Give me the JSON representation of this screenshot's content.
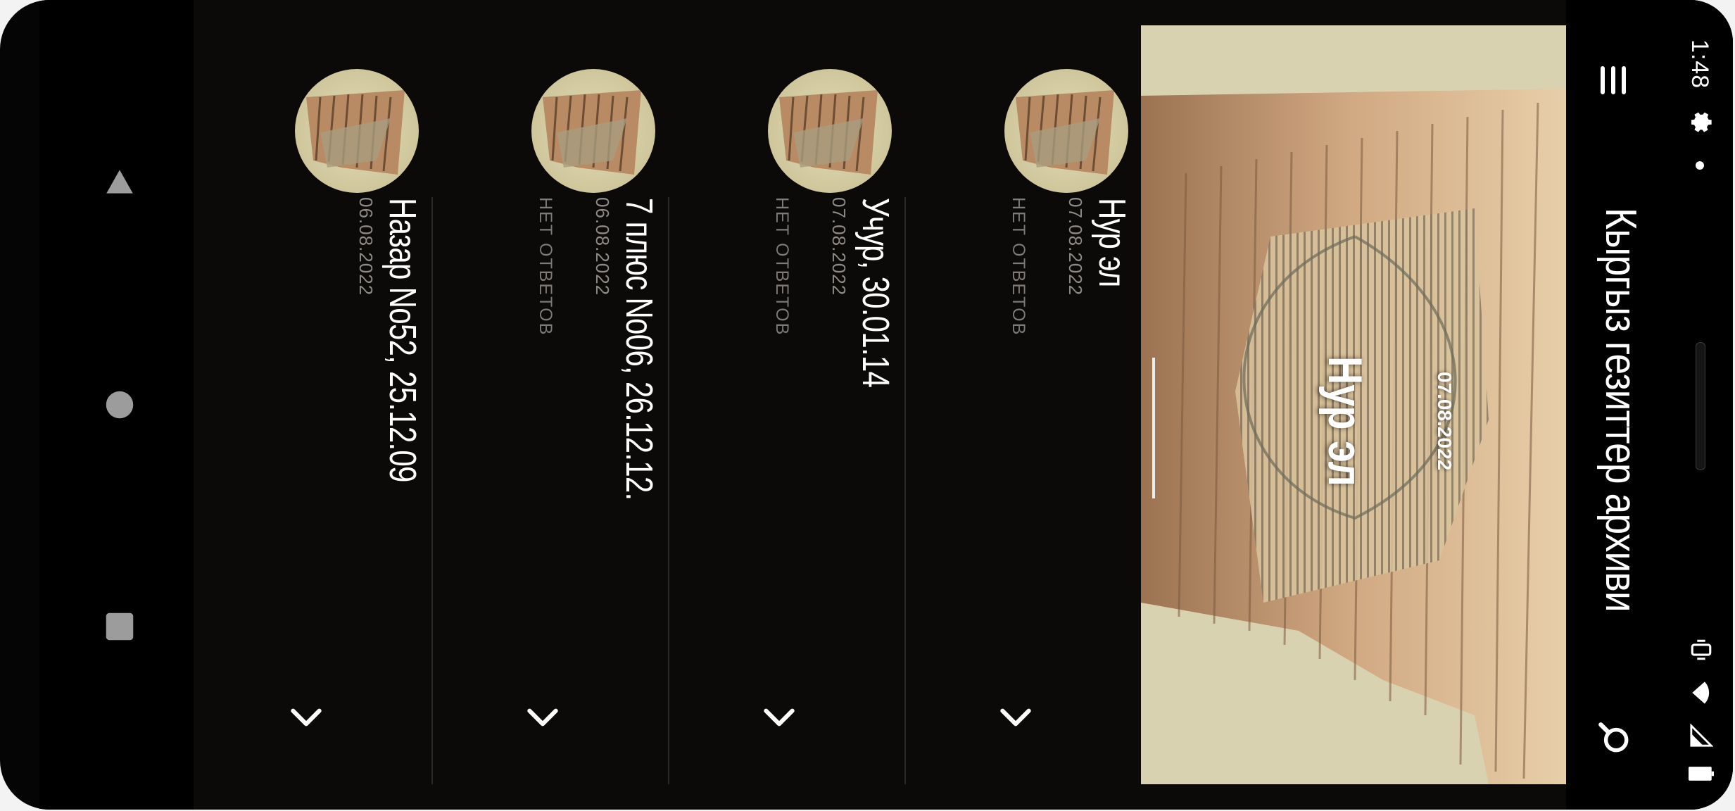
{
  "status_bar": {
    "time": "1:48",
    "icons": [
      "gear-icon",
      "notification-dot-icon",
      "vibrate-icon",
      "wifi-icon",
      "signal-icon",
      "battery-icon"
    ]
  },
  "app_bar": {
    "title": "Кыргыз гезиттер архиви",
    "menu_icon": "hamburger-menu-icon",
    "search_icon": "search-icon"
  },
  "featured": {
    "title": "Нур эл",
    "date": "07.08.2022"
  },
  "articles": [
    {
      "title": "Нур эл",
      "date": "07.08.2022",
      "replies": "НЕТ ОТВЕТОВ"
    },
    {
      "title": "Учур, 30.01.14",
      "date": "07.08.2022",
      "replies": "НЕТ ОТВЕТОВ"
    },
    {
      "title": "7 плюс No06, 26.12.12.",
      "date": "06.08.2022",
      "replies": "НЕТ ОТВЕТОВ"
    },
    {
      "title": "Назар No52, 25.12.09",
      "date": "06.08.2022",
      "replies": ""
    }
  ],
  "nav_bar": {
    "icons": [
      "back-icon",
      "home-icon",
      "recents-icon"
    ]
  },
  "colors": {
    "background": "#0b0a09",
    "text": "#ffffff",
    "muted_text": "#8e8a86",
    "paper": "#d8d2b1"
  }
}
